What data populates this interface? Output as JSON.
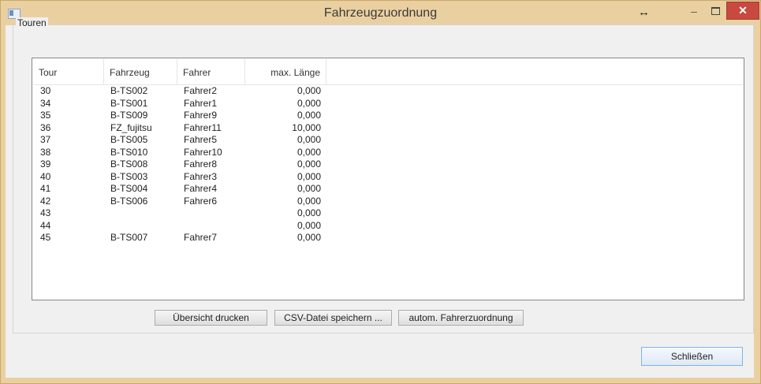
{
  "window": {
    "title": "Fahrzeugzuordnung",
    "resize_glyph": "↔",
    "min_glyph": "–",
    "close_glyph": "✕",
    "app_icon": "app-icon",
    "frame_color": "#ead0a0",
    "close_color": "#c7493f"
  },
  "group": {
    "label": "Touren"
  },
  "table": {
    "columns": [
      "Tour",
      "Fahrzeug",
      "Fahrer",
      "max. Länge"
    ],
    "rows": [
      [
        "30",
        "B-TS002",
        "Fahrer2",
        "0,000"
      ],
      [
        "34",
        "B-TS001",
        "Fahrer1",
        "0,000"
      ],
      [
        "35",
        "B-TS009",
        "Fahrer9",
        "0,000"
      ],
      [
        "36",
        "FZ_fujitsu",
        "Fahrer11",
        "10,000"
      ],
      [
        "37",
        "B-TS005",
        "Fahrer5",
        "0,000"
      ],
      [
        "38",
        "B-TS010",
        "Fahrer10",
        "0,000"
      ],
      [
        "39",
        "B-TS008",
        "Fahrer8",
        "0,000"
      ],
      [
        "40",
        "B-TS003",
        "Fahrer3",
        "0,000"
      ],
      [
        "41",
        "B-TS004",
        "Fahrer4",
        "0,000"
      ],
      [
        "42",
        "B-TS006",
        "Fahrer6",
        "0,000"
      ],
      [
        "43",
        "",
        "",
        "0,000"
      ],
      [
        "44",
        "",
        "",
        "0,000"
      ],
      [
        "45",
        "B-TS007",
        "Fahrer7",
        "0,000"
      ]
    ]
  },
  "buttons": {
    "print": "Übersicht drucken",
    "csv": "CSV-Datei speichern ...",
    "auto": "autom. Fahrerzuordnung",
    "close": "Schließen"
  }
}
